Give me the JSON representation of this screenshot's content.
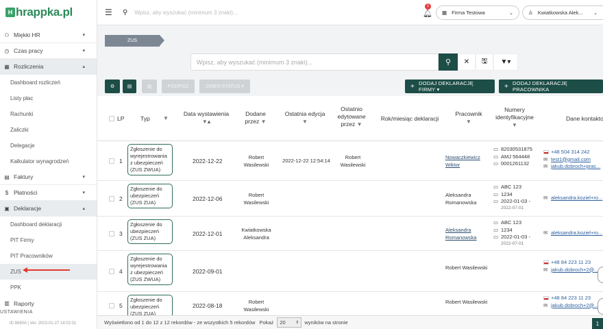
{
  "brand": {
    "logo_mark": "H",
    "name": "hrappka.pl"
  },
  "sidebar": {
    "sections": [
      {
        "label": "Miękki HR",
        "icon": "handshake-icon"
      },
      {
        "label": "Czas pracy",
        "icon": "clock-icon"
      },
      {
        "label": "Rozliczenia",
        "icon": "calculator-icon",
        "open": true
      }
    ],
    "rozliczenia_items": [
      "Dashboard rozliczeń",
      "Listy płac",
      "Rachunki",
      "Zaliczki",
      "Delegacje",
      "Kalkulator wynagrodzeń"
    ],
    "sections2": [
      {
        "label": "Faktury",
        "icon": "invoice-icon"
      },
      {
        "label": "Płatności",
        "icon": "dollar-icon"
      },
      {
        "label": "Deklaracje",
        "icon": "document-icon",
        "open": true
      }
    ],
    "deklaracje_items": [
      "Dashboard deklaracji",
      "PIT Firmy",
      "PIT Pracowników",
      "ZUS",
      "PPK"
    ],
    "raporty": "Raporty",
    "ustawienia": "USTAWIENIA",
    "version": "ID 8690A | Ver. 2023-01-27 14:02:01"
  },
  "topbar": {
    "search_placeholder": "Wpisz, aby wyszukać (minimum 3 znaki)...",
    "notifications": "1",
    "company": "Firma Testowa",
    "user": "Kwiatkowska Alek..."
  },
  "breadcrumb": "ZUS",
  "search": {
    "placeholder": "Wpisz, aby wyszukać (minimum 3 znaki)..."
  },
  "toolbar": {
    "podpisz": "PODPISZ",
    "zmien_status": "ZMIEŃ STATUS ▾",
    "add_firm": "DODAJ DEKLARACJĘ FIRMY ▾",
    "add_employee": "DODAJ DEKLARACJĘ PRACOWNIKA"
  },
  "table": {
    "headers": {
      "lp": "LP",
      "typ": "Typ",
      "data": "Data wystawienia",
      "dodane": "Dodane przez",
      "ostatnia": "Ostatnia edycja",
      "ostatnio": "Ostatnio edytowane przez",
      "rok": "Rok/miesiąc deklaracji",
      "pracownik": "Pracownik",
      "numery": "Numery identyfikacyjne",
      "dane": "Dane kontaktowe"
    },
    "rows": [
      {
        "lp": "1",
        "typ": "Zgłoszenie do wyrejestrowania z ubezpieczeń (ZUS ZWUA)",
        "data": "2022-12-22",
        "dodane": "Robert Wasilewski",
        "ostatnia": "2022-12-22 12:54:14",
        "ostatnio": "Robert Wasilewski",
        "pracownik": "Nowaczkiewicz Wiktor",
        "pracownik_link": true,
        "ids": [
          "82030531875",
          "AMJ 564448",
          "0001261132"
        ],
        "ids_small": [],
        "phone": "+48 504 314 242",
        "emails": [
          "test1@gmail.com",
          "jakub.dobroch+prac..."
        ]
      },
      {
        "lp": "2",
        "typ": "Zgłoszenie do ubezpieczeń (ZUS ZUA)",
        "data": "2022-12-06",
        "dodane": "Robert Wasilewski",
        "ostatnia": "",
        "ostatnio": "",
        "pracownik": "Aleksandra Romanowska",
        "pracownik_link": false,
        "ids": [
          "ABC 123",
          "1234",
          "2022-01-03 -"
        ],
        "ids_small": [
          "2022-07-01"
        ],
        "phone": "",
        "emails": [
          "aleksandra.koziel+ro..."
        ]
      },
      {
        "lp": "3",
        "typ": "Zgłoszenie do ubezpieczeń (ZUS ZUA)",
        "data": "2022-12-01",
        "dodane": "Kwiatkowska Aleksandra",
        "ostatnia": "",
        "ostatnio": "",
        "pracownik": "Aleksandra Romanowska",
        "pracownik_link": true,
        "ids": [
          "ABC 123",
          "1234",
          "2022-01-03 -"
        ],
        "ids_small": [
          "2022-07-01"
        ],
        "phone": "",
        "emails": [
          "aleksandra.koziel+ro..."
        ]
      },
      {
        "lp": "4",
        "typ": "Zgłoszenie do wyrejestrowania z ubezpieczeń (ZUS ZWUA)",
        "data": "2022-09-01",
        "dodane": "",
        "ostatnia": "",
        "ostatnio": "",
        "pracownik": "Robert Wasilewski",
        "pracownik_link": false,
        "ids": [],
        "ids_small": [],
        "phone": "+48 84 223 11 23",
        "emails": [
          "jakub.dobroch+2@..."
        ]
      },
      {
        "lp": "5",
        "typ": "Zgłoszenie do ubezpieczeń (ZUS ZUA)",
        "data": "2022-08-18",
        "dodane": "Robert Wasilewski",
        "ostatnia": "",
        "ostatnio": "",
        "pracownik": "Robert Wasilewski",
        "pracownik_link": false,
        "ids": [],
        "ids_small": [],
        "phone": "+48 84 223 11 23",
        "emails": [
          "jakub.dobroch+2@..."
        ]
      }
    ]
  },
  "footer": {
    "summary": "Wyświetlono od 1 do 12 z 12 rekordów - ze wszystkich 5 rekordów",
    "show": "Pokaż",
    "page_size": "20",
    "per_page": "wyników na stronie",
    "page": "1"
  }
}
